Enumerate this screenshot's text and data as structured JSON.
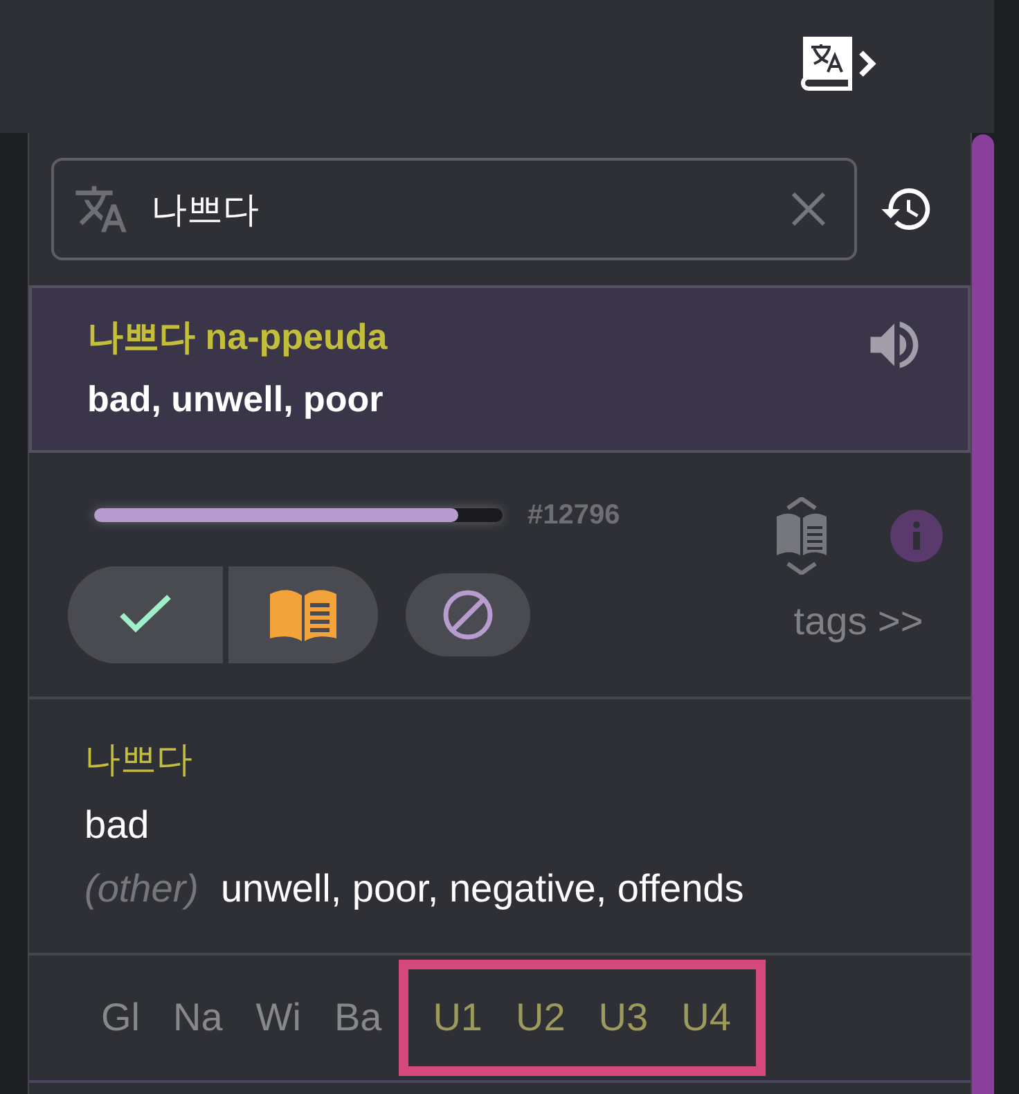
{
  "search": {
    "value": "나쁘다"
  },
  "result": {
    "word": "나쁘다 na-ppeuda",
    "meaning": "bad, unwell, poor"
  },
  "progress": {
    "level": 0.89,
    "id": "#12796"
  },
  "tags_link": "tags >>",
  "definition": {
    "word": "나쁘다",
    "primary": "bad",
    "other_label": "(other)",
    "other": "unwell, poor, negative, offends"
  },
  "sources": [
    {
      "label": "Gl",
      "kind": "builtin"
    },
    {
      "label": "Na",
      "kind": "builtin"
    },
    {
      "label": "Wi",
      "kind": "builtin"
    },
    {
      "label": "Ba",
      "kind": "builtin"
    },
    {
      "label": "U1",
      "kind": "user"
    },
    {
      "label": "U2",
      "kind": "user"
    },
    {
      "label": "U3",
      "kind": "user"
    },
    {
      "label": "U4",
      "kind": "user"
    }
  ]
}
